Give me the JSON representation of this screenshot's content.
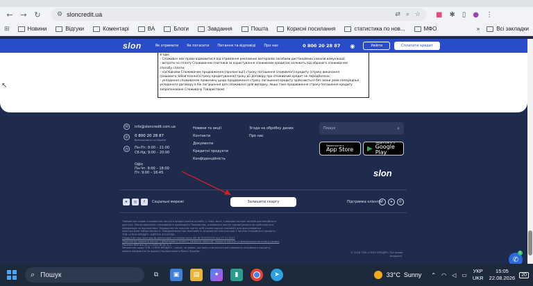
{
  "browser": {
    "url": "sloncredit.ua",
    "bookmarks": [
      "Новини",
      "Відгуки",
      "Коментарі",
      "ВА",
      "Блоги",
      "Завдання",
      "Пошта",
      "Корисні посилання",
      "статистика по нов...",
      "МФО"
    ],
    "all_bookmarks": "Всі закладки"
  },
  "site_header": {
    "logo": "slon",
    "nav": [
      "Як отримати",
      "Як погасити",
      "Питання та відповіді",
      "Про нас"
    ],
    "phone": "0 800 20 28 87",
    "login": "Увійти",
    "pay": "Сплатити кредит"
  },
  "notice_lines": [
    "згоди;",
    "– Споживач має право відмовитися від отримання рекламних матеріалів засобами дистанційних каналів комунікації;",
    "– витрати на сплату Споживачем платежів за користування споживчим кредитом залежать від обраного споживачем",
    "способу сплати;",
    "– наслідками Споживачем продовження (пролонгації) строку погашення споживчого кредиту (строку виконання",
    "грошового зобов'язання)/строку кредитування/строку дії договору про споживчий кредит не передбачено;",
    "– укладення споживачем правочину щодо продовження строку погашення кредиту здійснюється без зміни умов попередньо",
    "укладеного договору в бік погіршення для споживача (для випадку, якщо таке продовження строку погашення кредиту",
    "запропоноване Споживачу Товариством) ."
  ],
  "footer": {
    "email": "info@sloncredit.com.ua",
    "phone": "0 800 20 28 87",
    "phone_note": "безкоштовно по Україні",
    "hours": [
      "Пн-Пт: 9:00 – 21:00",
      "Сб-Нд: 9:00 – 20:00"
    ],
    "office_label": "Офіс",
    "office_hours": [
      "Пн-Чт: 9:00 – 18:00",
      "Пт: 9:00 – 16:45"
    ],
    "links_col1": [
      "Новини та акції",
      "Контакти",
      "Документи",
      "Кредитні продукти",
      "Конфіденційність"
    ],
    "links_col2": [
      "Згода на обробку даних",
      "Про нас"
    ],
    "search_placeholder": "Пошук",
    "appstore_small": "Завантажте в",
    "appstore_big": "App Store",
    "gplay_small": "ЗАВАНТАЖТЕ З",
    "gplay_big": "Google Play",
    "logo": "slon",
    "social_label": "Соціальні мережі",
    "complaint_button": "Залишити скаргу",
    "support_label": "Підтримка клієнтів",
    "legal_lines": [
      "Товариство надає споживачам послуги кредитування онлайн, у тому числі, з використанням засобів дистанційного",
      "доступу. Обслуговування споживачів в приміщенні Товариства, отримання послуг кредитування не здійснюється.",
      "Інформація за посиланням. Товариство не залучає третіх осіб (колекторські компанії) для врегулювання",
      "простроченої заборгованості. Повідомляємо про можливість отримання консультації з питань споживчого кредиту.",
      "ТОВ «СЛОН КРЕДИТ» ЄДРПОУ 41193764",
      "Свідоцтво про реєстрацію фінансової установи серія ФК № 001031000 від 27.12.2017",
      "Ліцензія на надання послуг з фінансового лізингу, надання гарантій, надання коштів та банківських металів у позику",
      "Рішення НБУ від 24.11.2022 № 42 3-7.",
      "Звернення щодо ТОВ «СЛОН КРЕДИТ», також, за умови, що вони стосуються регулювання споживчого кредиту,",
      "можна направити на адресу Національного банку України."
    ],
    "copyright": "© 2026 ТОВ «СЛОН КРЕДИТ». Всі права захищені."
  },
  "taskbar": {
    "search": "Пошук",
    "temperature": "33°C",
    "weather": "Sunny",
    "lang": "УКР",
    "lang2": "UKR",
    "time": "15:05",
    "date": "22.08.2026",
    "notifications": "20"
  }
}
